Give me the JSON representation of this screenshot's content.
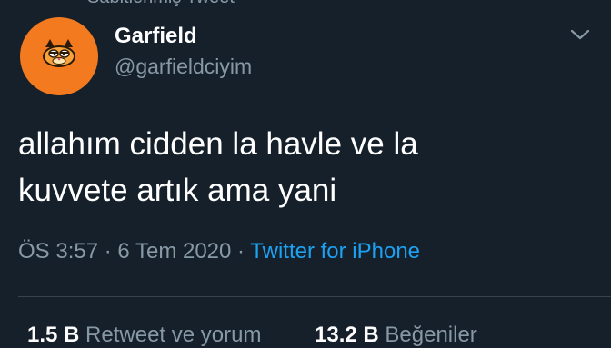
{
  "pinned_label": "Sabitlenmiş Tweet",
  "user": {
    "name": "Garfield",
    "handle": "@garfieldciyim"
  },
  "tweet": {
    "lines": [
      "allahım cidden la havle ve la",
      "kuvvete artık ama yani"
    ]
  },
  "meta": {
    "time": "ÖS 3:57",
    "separator1": " · ",
    "date": "6 Tem 2020",
    "separator2": " · ",
    "source": "Twitter for iPhone"
  },
  "stats": {
    "retweets": {
      "count": "1.5 B",
      "label": "Retweet ve yorum"
    },
    "likes": {
      "count": "13.2 B",
      "label": "Beğeniler"
    }
  },
  "icons": {
    "avatar": "garfield-avatar",
    "caret": "chevron-down-icon"
  },
  "colors": {
    "background": "#15202b",
    "secondary_text": "#8899a6",
    "link": "#1da1f2",
    "avatar_bg": "#f47a1f"
  }
}
